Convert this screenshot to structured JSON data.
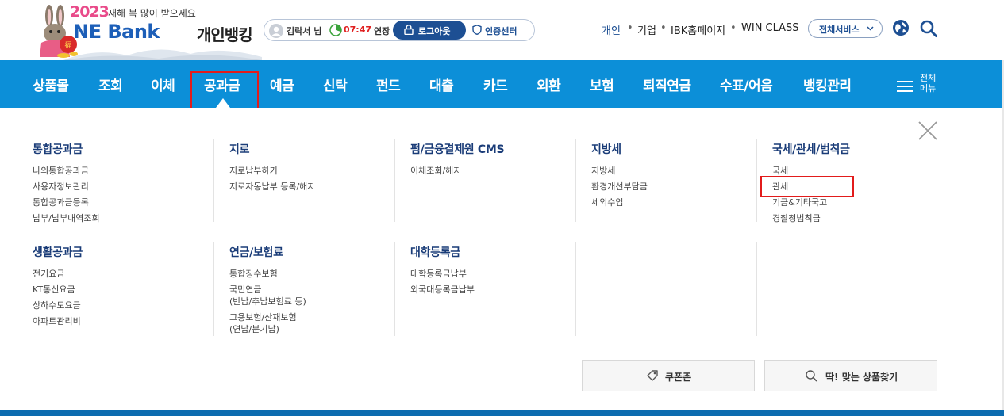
{
  "header": {
    "logo": {
      "year": "2023",
      "greeting": "새해 복 많이 받으세요",
      "bank_name": "NE Bank",
      "service_title": "개인뱅킹"
    },
    "session": {
      "user_name": "김락서 님",
      "remaining_time": "07:47",
      "extend_label": "연장",
      "logout_label": "로그아웃",
      "cert_center_label": "인증센터"
    },
    "utility_links": [
      "개인",
      "기업",
      "IBK홈페이지",
      "WIN CLASS"
    ],
    "separator": "•",
    "all_services_label": "전체서비스"
  },
  "nav": {
    "items": [
      "상품몰",
      "조회",
      "이체",
      "공과금",
      "예금",
      "신탁",
      "펀드",
      "대출",
      "카드",
      "외환",
      "보험",
      "퇴직연금",
      "수표/어음",
      "뱅킹관리"
    ],
    "active_item": "공과금",
    "all_menu_label_line1": "전체",
    "all_menu_label_line2": "메뉴"
  },
  "mega_menu": {
    "sections": [
      {
        "title": "통합공과금",
        "items": [
          "나의통합공과금",
          "사용자정보관리",
          "통합공과금등록",
          "납부/납부내역조회"
        ]
      },
      {
        "title": "지로",
        "items": [
          "지로납부하기",
          "지로자동납부 등록/해지"
        ]
      },
      {
        "title": "펌/금융결제원 CMS",
        "items": [
          "이체조회/해지"
        ]
      },
      {
        "title": "지방세",
        "items": [
          "지방세",
          "환경개선부담금",
          "세외수입"
        ]
      },
      {
        "title": "국세/관세/범칙금",
        "items": [
          "국세",
          "관세",
          "기금&기타국고",
          "경찰청범칙금"
        ]
      },
      {
        "title": "생활공과금",
        "items": [
          "전기요금",
          "KT통신요금",
          "상하수도요금",
          "아파트관리비"
        ]
      },
      {
        "title": "연금/보험료",
        "items": [
          "통합징수보험",
          "국민연금",
          "(반납/추납보험료 등)",
          "고용보험/산재보험",
          "(연납/분기납)"
        ]
      },
      {
        "title": "대학등록금",
        "items": [
          "대학등록금납부",
          "외국대등록금납부"
        ]
      }
    ],
    "highlighted_item": "관세",
    "coupon_label": "쿠폰존",
    "product_finder_label": "딱! 맞는 상품찾기"
  },
  "colors": {
    "nav_bg": "#0c8fd8",
    "brand_blue": "#1d4f93",
    "highlight_red": "#e21b1b",
    "timer_red": "#e02020"
  },
  "icons": [
    "rabbit-mascot-icon",
    "user-icon",
    "timer-icon",
    "lock-icon",
    "shield-icon",
    "chevron-down-icon",
    "globe-icon",
    "search-icon",
    "hamburger-icon",
    "close-icon",
    "coupon-icon",
    "magnifier-icon"
  ]
}
